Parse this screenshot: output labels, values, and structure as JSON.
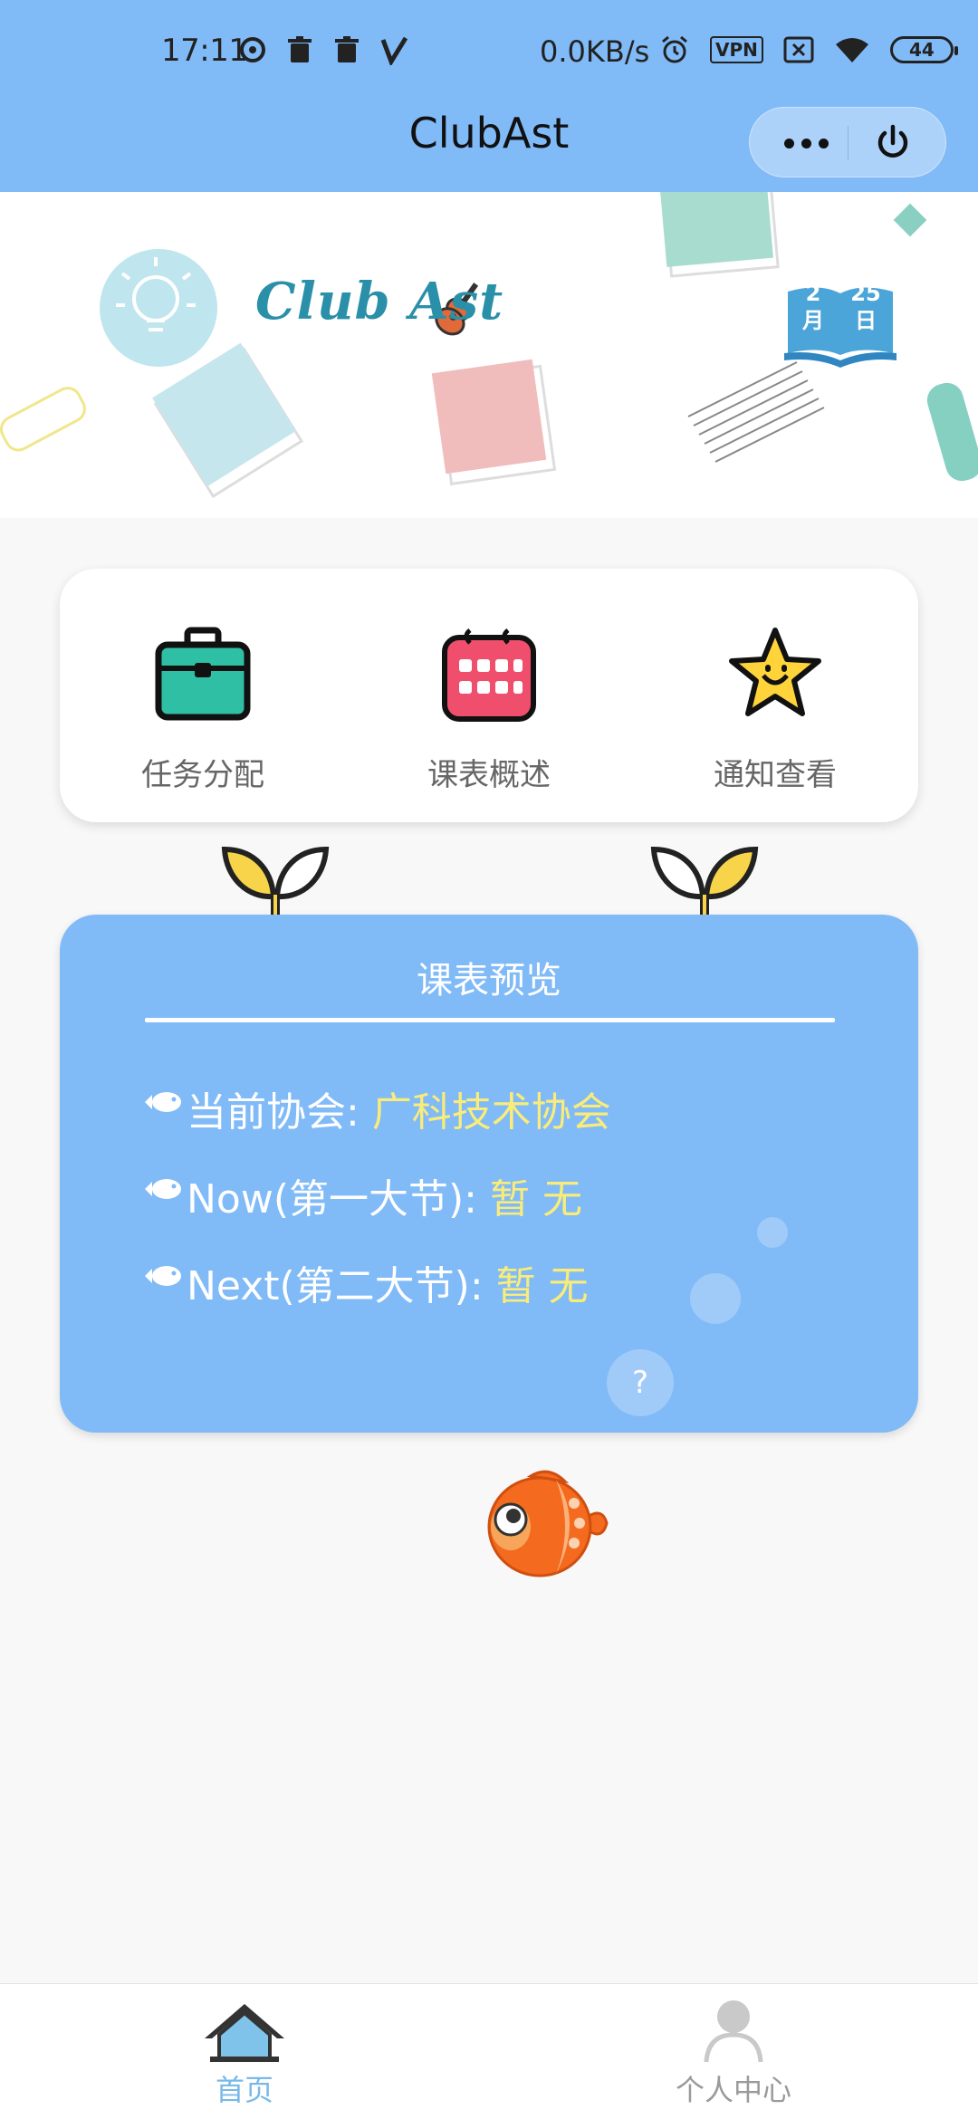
{
  "status_bar": {
    "time": "17:11",
    "network_speed": "0.0KB/s",
    "vpn_label": "VPN",
    "battery": "44",
    "left_icons": [
      "data-saver-icon",
      "trash-icon",
      "trash-icon",
      "check-v-icon"
    ],
    "right_icons": [
      "alarm-icon",
      "vpn-icon",
      "sim-off-icon",
      "wifi-icon",
      "battery-icon"
    ]
  },
  "nav": {
    "title": "ClubAst",
    "capsule_icons": [
      "more-dots-icon",
      "power-icon"
    ]
  },
  "banner": {
    "brand": "Club Ast",
    "calendar_month": "2",
    "calendar_month_unit": "月",
    "calendar_day": "25",
    "calendar_day_unit": "日"
  },
  "menu": {
    "items": [
      {
        "label": "任务分配",
        "icon": "briefcase-icon"
      },
      {
        "label": "课表概述",
        "icon": "calendar-icon"
      },
      {
        "label": "通知查看",
        "icon": "star-icon"
      }
    ]
  },
  "preview": {
    "title": "课表预览",
    "rows": [
      {
        "label": "当前协会: ",
        "value": "广科技术协会"
      },
      {
        "label": "Now(第一大节): ",
        "value": "暂 无"
      },
      {
        "label": "Next(第二大节): ",
        "value": "暂 无"
      }
    ],
    "help": "?"
  },
  "tabbar": {
    "tabs": [
      {
        "label": "首页",
        "icon": "home-icon",
        "active": true
      },
      {
        "label": "个人中心",
        "icon": "user-icon",
        "active": false
      }
    ]
  },
  "colors": {
    "primary": "#80baf7",
    "highlight": "#f9ec7a",
    "tab_active": "#79b9e8"
  }
}
